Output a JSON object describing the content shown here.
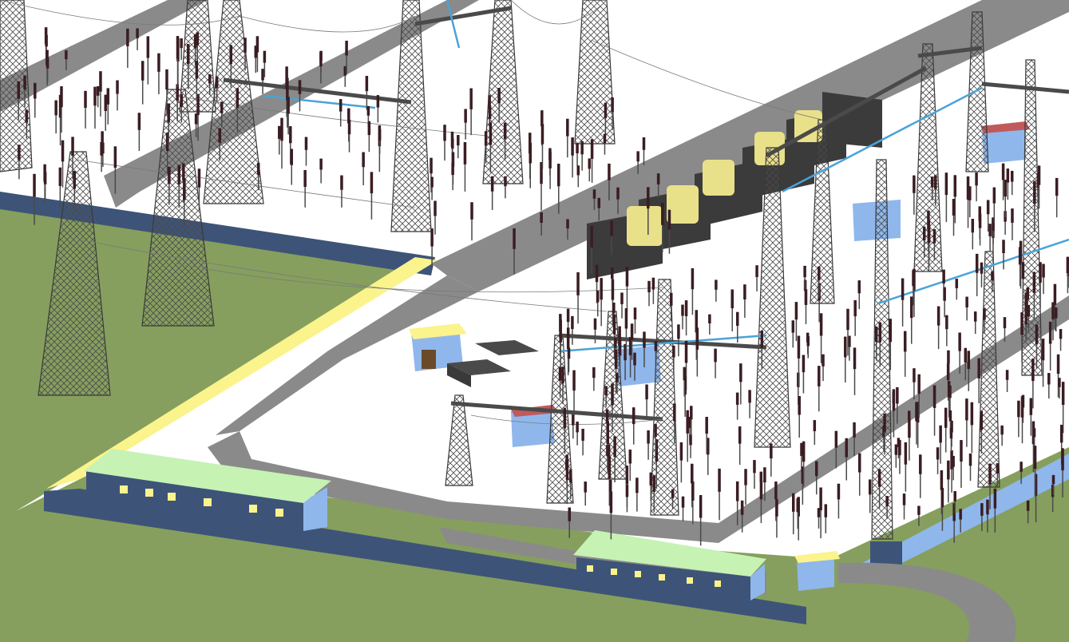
{
  "scene": {
    "subject": "",
    "colors": {
      "ground": "#869f5e",
      "yard": "#ffffff",
      "road": "#8a8a8a",
      "wall_top": "#fbf38c",
      "wall_side": "#3d5478",
      "wall_light": "#8fb7ec",
      "roof": "#c6f2b4",
      "building_wall": "#3d5478",
      "building_side": "#8fb7ec",
      "transformer_panel": "#3b3b3b",
      "transformer_body": "#e9e08a",
      "steel": "#5a5a5a",
      "insulator": "#3a1d22",
      "busbar": "#4aa3d8"
    }
  }
}
